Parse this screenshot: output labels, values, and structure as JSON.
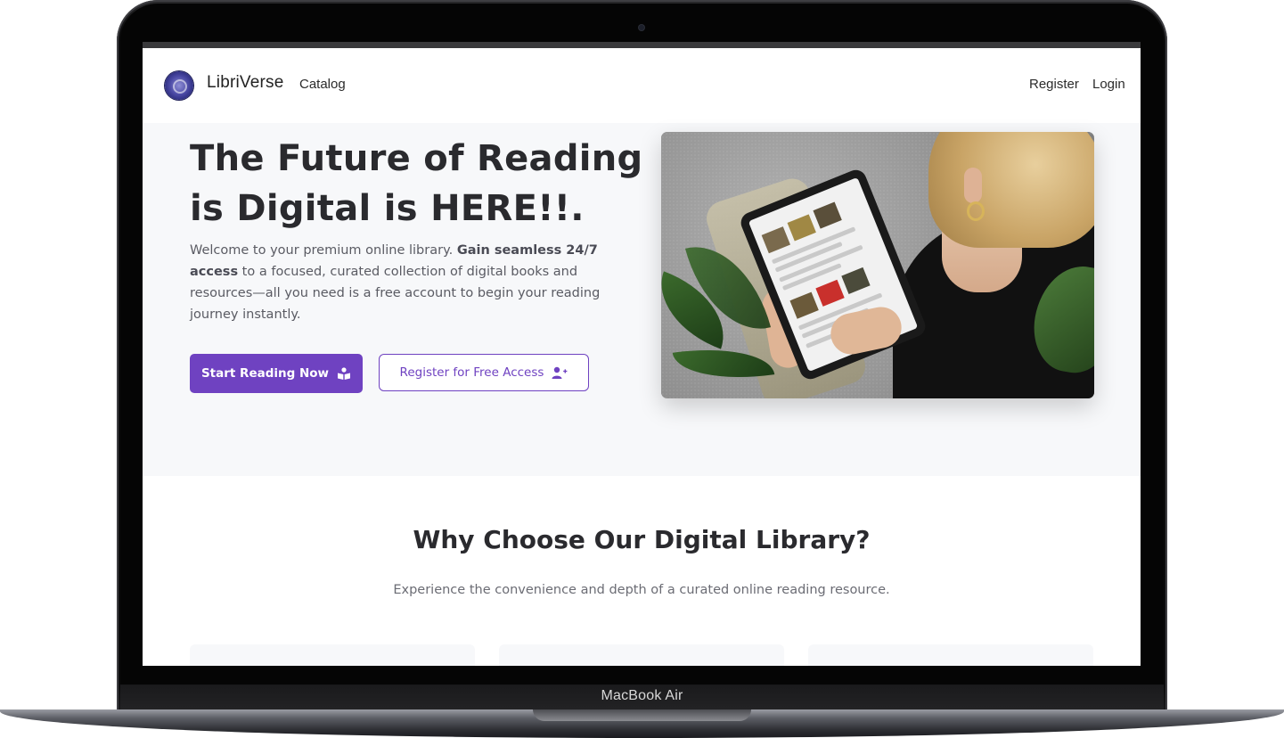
{
  "device": {
    "label": "MacBook Air"
  },
  "navbar": {
    "brand": "LibriVerse",
    "links": {
      "catalog": "Catalog",
      "register": "Register",
      "login": "Login"
    }
  },
  "hero": {
    "title": "The Future of Reading is Digital is HERE!!.",
    "description": {
      "intro": "Welcome to your premium online library. ",
      "bold": "Gain seamless 24/7 access",
      "rest": " to a focused, curated collection of digital books and resources—all you need is a free account to begin your reading journey instantly."
    },
    "primary_button": {
      "label": "Start Reading Now",
      "icon": "book-reader-icon"
    },
    "secondary_button": {
      "label": "Register for Free Access",
      "icon": "user-plus-icon"
    }
  },
  "features": {
    "title": "Why Choose Our Digital Library?",
    "subtitle": "Experience the convenience and depth of a curated online reading resource."
  },
  "colors": {
    "accent": "#6f42c1",
    "hero_bg": "#f7f8fa",
    "text_dark": "#2a2a2e"
  }
}
